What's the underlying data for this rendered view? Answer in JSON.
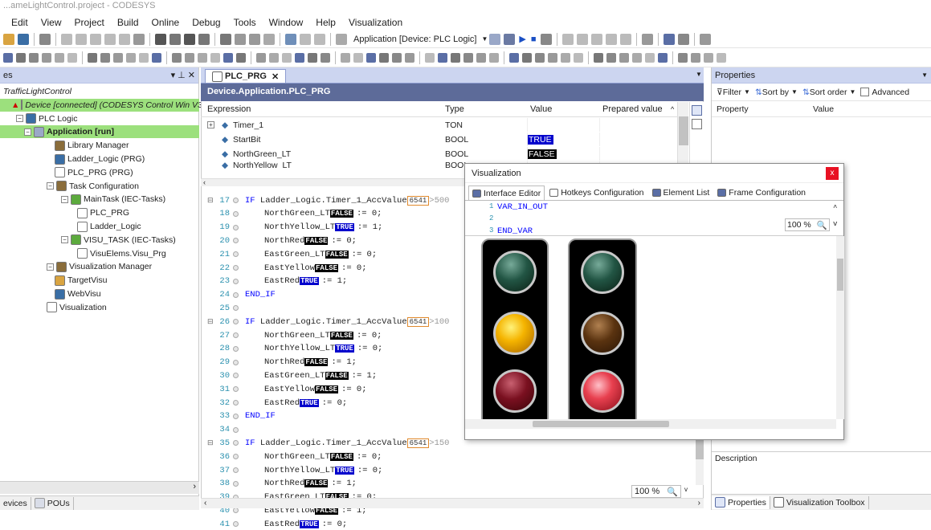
{
  "window": {
    "title": "...ameLightControl.project - CODESYS"
  },
  "menu": [
    "Edit",
    "View",
    "Project",
    "Build",
    "Online",
    "Debug",
    "Tools",
    "Window",
    "Help",
    "Visualization"
  ],
  "toolbar": {
    "app_selector": "Application [Device: PLC Logic]"
  },
  "devices_panel": {
    "title": "es",
    "items": [
      {
        "label": "TrafficLightControl"
      },
      {
        "label": "Device [connected] (CODESYS Control Win V3"
      },
      {
        "label": "PLC Logic"
      },
      {
        "label": "Application [run]"
      },
      {
        "label": "Library Manager"
      },
      {
        "label": "Ladder_Logic (PRG)"
      },
      {
        "label": "PLC_PRG (PRG)"
      },
      {
        "label": "Task Configuration"
      },
      {
        "label": "MainTask (IEC-Tasks)"
      },
      {
        "label": "PLC_PRG"
      },
      {
        "label": "Ladder_Logic"
      },
      {
        "label": "VISU_TASK (IEC-Tasks)"
      },
      {
        "label": "VisuElems.Visu_Prg"
      },
      {
        "label": "Visualization Manager"
      },
      {
        "label": "TargetVisu"
      },
      {
        "label": "WebVisu"
      },
      {
        "label": "Visualization"
      }
    ],
    "bottom_tabs": [
      "evices",
      "POUs"
    ]
  },
  "editor": {
    "tab": "PLC_PRG",
    "path": "Device.Application.PLC_PRG",
    "watch_headers": [
      "Expression",
      "Type",
      "Value",
      "Prepared value"
    ],
    "watch_rows": [
      {
        "expr": "Timer_1",
        "type": "TON",
        "value": ""
      },
      {
        "expr": "StartBit",
        "type": "BOOL",
        "value": "TRUE"
      },
      {
        "expr": "NorthGreen_LT",
        "type": "BOOL",
        "value": "FALSE"
      },
      {
        "expr": "NorthYellow_LT",
        "type": "BOOL",
        "value": ""
      }
    ],
    "code_lines": [
      {
        "n": "17",
        "kind": "if",
        "pre": "IF Ladder_Logic.Timer_1_AccValue",
        "val": "6541",
        "post": ">500"
      },
      {
        "n": "18",
        "kind": "asg",
        "var": "NorthGreen_LT",
        "state": "FALSE",
        "rhs": ":= 0;"
      },
      {
        "n": "19",
        "kind": "asg",
        "var": "NorthYellow_LT",
        "state": "TRUE",
        "rhs": ":= 1;"
      },
      {
        "n": "20",
        "kind": "asg",
        "var": "NorthRed",
        "state": "FALSE",
        "rhs": ":= 0;"
      },
      {
        "n": "21",
        "kind": "asg",
        "var": "EastGreen_LT",
        "state": "FALSE",
        "rhs": ":= 0;"
      },
      {
        "n": "22",
        "kind": "asg",
        "var": "EastYellow",
        "state": "FALSE",
        "rhs": ":= 0;"
      },
      {
        "n": "23",
        "kind": "asg",
        "var": "EastRed",
        "state": "TRUE",
        "rhs": ":= 1;"
      },
      {
        "n": "24",
        "kind": "end",
        "text": "END_IF"
      },
      {
        "n": "25",
        "kind": "blank"
      },
      {
        "n": "26",
        "kind": "if",
        "pre": "IF Ladder_Logic.Timer_1_AccValue",
        "val": "6541",
        "post": ">100"
      },
      {
        "n": "27",
        "kind": "asg",
        "var": "NorthGreen_LT",
        "state": "FALSE",
        "rhs": ":= 0;"
      },
      {
        "n": "28",
        "kind": "asg",
        "var": "NorthYellow_LT",
        "state": "TRUE",
        "rhs": ":= 0;"
      },
      {
        "n": "29",
        "kind": "asg",
        "var": "NorthRed",
        "state": "FALSE",
        "rhs": ":= 1;"
      },
      {
        "n": "30",
        "kind": "asg",
        "var": "EastGreen_LT",
        "state": "FALSE",
        "rhs": ":= 1;"
      },
      {
        "n": "31",
        "kind": "asg",
        "var": "EastYellow",
        "state": "FALSE",
        "rhs": ":= 0;"
      },
      {
        "n": "32",
        "kind": "asg",
        "var": "EastRed",
        "state": "TRUE",
        "rhs": ":= 0;"
      },
      {
        "n": "33",
        "kind": "end",
        "text": "END_IF"
      },
      {
        "n": "34",
        "kind": "blank"
      },
      {
        "n": "35",
        "kind": "if",
        "pre": "IF Ladder_Logic.Timer_1_AccValue",
        "val": "6541",
        "post": ">150"
      },
      {
        "n": "36",
        "kind": "asg",
        "var": "NorthGreen_LT",
        "state": "FALSE",
        "rhs": ":= 0;"
      },
      {
        "n": "37",
        "kind": "asg",
        "var": "NorthYellow_LT",
        "state": "TRUE",
        "rhs": ":= 0;"
      },
      {
        "n": "38",
        "kind": "asg",
        "var": "NorthRed",
        "state": "FALSE",
        "rhs": ":= 1;"
      },
      {
        "n": "39",
        "kind": "asg",
        "var": "EastGreen_LT",
        "state": "FALSE",
        "rhs": ":= 0;"
      },
      {
        "n": "40",
        "kind": "asg",
        "var": "EastYellow",
        "state": "FALSE",
        "rhs": ":= 1;"
      },
      {
        "n": "41",
        "kind": "asg",
        "var": "EastRed",
        "state": "TRUE",
        "rhs": ":= 0;"
      }
    ],
    "zoom": "100 %"
  },
  "visu_window": {
    "title": "Visualization",
    "tabs": [
      "Interface Editor",
      "Hotkeys Configuration",
      "Element List",
      "Frame Configuration"
    ],
    "code": [
      "VAR_IN_OUT",
      "",
      "END_VAR"
    ],
    "line_numbers": [
      "1",
      "2",
      "3"
    ],
    "zoom": "100 %",
    "lights": {
      "north": {
        "green": "off",
        "yellow": "on",
        "red": "off"
      },
      "east": {
        "green": "off",
        "yellow": "off",
        "red": "on"
      }
    }
  },
  "properties": {
    "title": "Properties",
    "filter": "Filter",
    "sort_by": "Sort by",
    "sort_order": "Sort order",
    "advanced": "Advanced",
    "col_property": "Property",
    "col_value": "Value",
    "description": "Description",
    "bottom_tabs": [
      "Properties",
      "Visualization Toolbox"
    ]
  },
  "colors": {
    "accent": "#5d6b99",
    "selected": "#9ce07d",
    "red_x": "#e81123"
  }
}
